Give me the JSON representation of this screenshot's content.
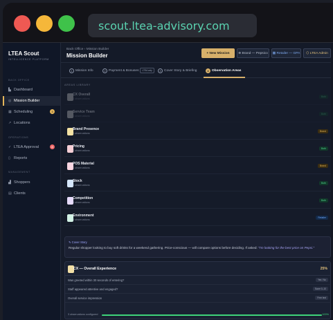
{
  "browser": {
    "url": "scout.ltea-advisory.com"
  },
  "sidebar": {
    "title": "LTEA Scout",
    "subtitle": "INTELLIGENCE PLATFORM",
    "sections": [
      "BACK OFFICE",
      "OPERATIONS",
      "MANAGEMENT"
    ],
    "items": [
      {
        "label": "Dashboard",
        "icon": "chart-icon",
        "glyph": "▙",
        "active": false
      },
      {
        "label": "Mission Builder",
        "icon": "target-icon",
        "glyph": "◎",
        "active": true
      },
      {
        "label": "Scheduling",
        "icon": "calendar-icon",
        "glyph": "▦",
        "active": false,
        "badge": "3",
        "badge_color": "#e5b65a"
      },
      {
        "label": "Locations",
        "icon": "pin-icon",
        "glyph": "↗",
        "active": false
      },
      {
        "label": "LTEA Approval",
        "icon": "check-icon",
        "glyph": "✓",
        "active": false,
        "badge": "8",
        "badge_color": "#f06a6a"
      },
      {
        "label": "Reports",
        "icon": "report-icon",
        "glyph": "▯",
        "active": false
      },
      {
        "label": "Shoppers",
        "icon": "users-icon",
        "glyph": "▟",
        "active": false
      },
      {
        "label": "Clients",
        "icon": "building-icon",
        "glyph": "▤",
        "active": false
      }
    ]
  },
  "header": {
    "breadcrumb": "Back Office › Mission Builder",
    "title": "Mission Builder",
    "new_mission": "+ New Mission",
    "brand": "⊕ Brand — Pepsico",
    "retailer": "▦ Retailer — GPA",
    "admin": "⬡ LTEA Admin"
  },
  "tabs": [
    {
      "num": "1",
      "label": "Mission Info",
      "pill": ""
    },
    {
      "num": "2",
      "label": "Payment & Bonuses",
      "pill": "LTEA only"
    },
    {
      "num": "3",
      "label": "Cover Story & Briefing",
      "pill": ""
    },
    {
      "num": "4",
      "label": "Observation Areas",
      "pill": "",
      "active": true
    }
  ],
  "library": {
    "heading": "AREAS LIBRARY",
    "areas": [
      {
        "name": "CX Overall",
        "obs": "3 observations",
        "tag": "Both",
        "tag_type": "g",
        "color": "#c9c9c9",
        "faded": true
      },
      {
        "name": "Service Team",
        "obs": "4 observations",
        "tag": "Both",
        "tag_type": "g",
        "color": "#c9c9c9",
        "faded": true
      },
      {
        "name": "Brand Presence",
        "obs": "4 observations",
        "tag": "Brand",
        "tag_type": "b",
        "color": "#f4e2a4",
        "faded": false
      },
      {
        "name": "Pricing",
        "obs": "4 observations",
        "tag": "Both",
        "tag_type": "g",
        "color": "#f6cfd6",
        "faded": false
      },
      {
        "name": "POS Material",
        "obs": "4 observations",
        "tag": "Brand",
        "tag_type": "b",
        "color": "#fbd7e3",
        "faded": false
      },
      {
        "name": "Stock",
        "obs": "4 observations",
        "tag": "Both",
        "tag_type": "g",
        "color": "#d6e7fb",
        "faded": false
      },
      {
        "name": "Competition",
        "obs": "3 observations",
        "tag": "Both",
        "tag_type": "g",
        "color": "#e7dcfb",
        "faded": false
      },
      {
        "name": "Environment",
        "obs": "3 observations",
        "tag": "Retailer",
        "tag_type": "r",
        "color": "#d3f2e6",
        "faded": false
      }
    ]
  },
  "cover": {
    "heading": "✎ Cover Story",
    "text": "Regular shopper looking to buy soft drinks for a weekend gathering. Price-conscious — will compare options before deciding. If asked: ",
    "quote": "\"I'm looking for the best price on Pepsi.\""
  },
  "cx_card": {
    "title": "CX — Overall Experience",
    "percent": "25%",
    "questions": [
      {
        "text": "Was greeted within 30 seconds of entering?",
        "pill": "Yes / No"
      },
      {
        "text": "Staff appeared attentive and engaged?",
        "pill": "Score 0–10"
      },
      {
        "text": "Overall service impression",
        "pill": "Free text"
      }
    ],
    "footer": "3 observations configured",
    "progress": 100,
    "progress_label": "100%"
  }
}
